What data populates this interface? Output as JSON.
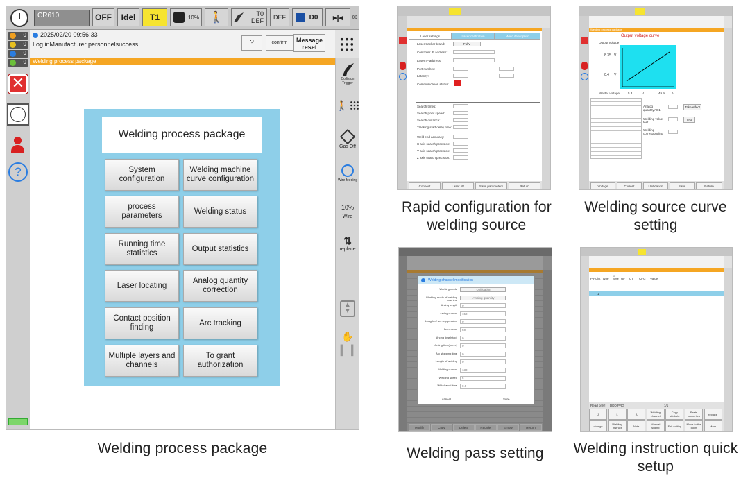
{
  "main": {
    "device": "CR610",
    "status_off": "OFF",
    "status_idle": "Idel",
    "status_t1": "T1",
    "speed": "10%",
    "tool_label": "T0",
    "tool_def": "DEF",
    "def": "DEF",
    "d0": "D0",
    "inf": "∞",
    "counters": [
      "0",
      "0",
      "0",
      "0"
    ],
    "timestamp": "2025/02/20 09:56:33",
    "log": "Log inManufacturer personnelsuccess",
    "help_btn": "?",
    "confirm_btn": "confirm",
    "reset_btn": "Message reset",
    "orange_bar": "Welding process package",
    "panel_title": "Welding process package",
    "menu": [
      "System configuration",
      "Welding machine curve configuration",
      "process parameters",
      "Welding status",
      "Running time statistics",
      "Output statistics",
      "Laser locating",
      "Analog quantity correction",
      "Contact position finding",
      "Arc tracking",
      "Multiple layers and channels",
      "To grant authorization"
    ],
    "right_panel": {
      "collision": "Collision Trigger",
      "gas": "Gas Off",
      "wire_feed": "Wire feeding",
      "wire_pct": "10%",
      "wire": "Wire",
      "replace": "replace"
    }
  },
  "captions": {
    "main": "Welding process package",
    "rapid": "Rapid configuration for welding source",
    "curve": "Welding source curve setting",
    "pass": "Welding pass setting",
    "instruction": "Welding instruction quick setup"
  },
  "thumb_rapid": {
    "tabs": [
      "Laser settings",
      "Laser calibration",
      "Weld description"
    ],
    "brand_label": "Laser tracker brand:",
    "brand_value": "FullV",
    "rows": [
      "Controller IP address:",
      "Laser IP address:",
      "Port number:",
      "Latency:",
      "Communication status:"
    ],
    "search_rows": [
      "Search times:",
      "Search point speed:",
      "Search distance:",
      "Tracking start delay time:"
    ],
    "trace_rows": [
      "Weld end accuracy:",
      "X axis search precision:",
      "Y axis search precision:",
      "Z axis search precision:"
    ],
    "buttons": [
      "Connect",
      "Laser off",
      "Save parameters",
      "Return"
    ]
  },
  "thumb_curve": {
    "bar": "Welding process package",
    "title": "Output voltage curve",
    "y_label": "Output voltage",
    "y_vals": [
      "8.35",
      "0.4"
    ],
    "x_label": "Welder voltage",
    "x_vals": [
      "5.3",
      "49.9"
    ],
    "unit": "V",
    "analog_label": "Analog quantityAO1",
    "take_effect": "Take effect",
    "test_label": "Welding value test",
    "test_btn": "Test",
    "corr_label": "Welding corresponding",
    "buttons": [
      "Voltage",
      "Current",
      "Unification",
      "Save",
      "Return"
    ]
  },
  "thumb_pass": {
    "title": "Welding channel modification",
    "rows": [
      {
        "label": "Working mode",
        "value": "Unification"
      },
      {
        "label": "Working mode of welding machine",
        "value": "Analog quantity"
      },
      {
        "label": "Arcing length",
        "value": "0"
      },
      {
        "label": "Arcing current",
        "value": "150"
      },
      {
        "label": "Length of arc suppression",
        "value": "0"
      },
      {
        "label": "Arc current",
        "value": "50"
      },
      {
        "label": "Arcing time(stop)",
        "value": "0"
      },
      {
        "label": "Arcing time(move)",
        "value": "0"
      },
      {
        "label": "Arc stopping time",
        "value": "0"
      },
      {
        "label": "Length of welding",
        "value": "0"
      },
      {
        "label": "Welding current",
        "value": "130"
      },
      {
        "label": "Welding speed",
        "value": "5"
      },
      {
        "label": "Withdrawal time",
        "value": "0.0"
      }
    ],
    "cancel": "cancel",
    "sure": "Sure",
    "bottom": [
      "Modify",
      "Copy",
      "Delete",
      "Reorder",
      "Empty",
      "Return"
    ]
  },
  "thumb_instr": {
    "headers": [
      "P Point",
      "type",
      "Gr name",
      "UF",
      "UT",
      "CFG",
      "Value"
    ],
    "row1": "1",
    "read_only": "Read only!",
    "prog": "DDD.PRG",
    "row_num": "1/1",
    "buttons1": [
      "J",
      "L",
      "A",
      "Welding channel",
      "Copy attribute",
      "Paste properties",
      "replace"
    ],
    "buttons2": [
      "change",
      "Welding instruct",
      "Note",
      "Manual sliding",
      "Exit editing",
      "Move to the point",
      "More"
    ]
  }
}
